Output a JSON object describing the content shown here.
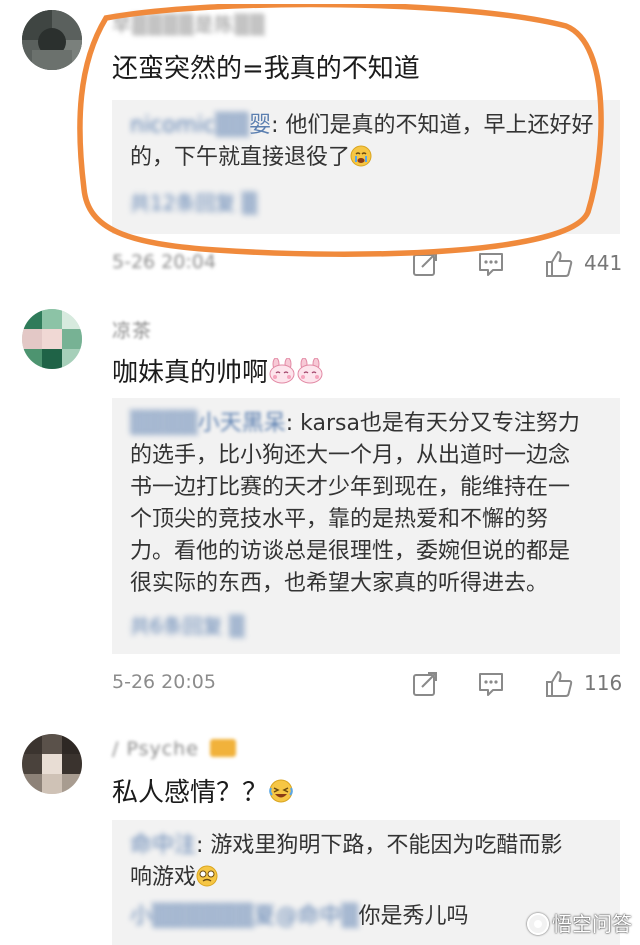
{
  "comments": [
    {
      "username": "早▒▒▒▒是陈▒▒",
      "text": "还蛮突然的=我真的不知道",
      "reply": {
        "user": "nicomic▒▒",
        "suffix": "婴",
        "lines": [
          "们是真的不知道，早上还好好",
          "的，下午就直接退役了"
        ],
        "colon": ": 他"
      },
      "more_replies": "共12条回复 ▒",
      "timestamp": "5-26 20:04",
      "likes": "441"
    },
    {
      "username": "凉茶",
      "text": "咖妹真的帅啊",
      "reply": {
        "user": "▒▒▒▒",
        "suffix": "小天黑呆",
        "lines": [
          "karsa也是有天分又专注努力",
          "的选手，比小狗还大一个月，从出道时一边念",
          "书一边打比赛的天才少年到现在，能维持在一",
          "个顶尖的竞技水平，靠的是热爱和不懈的努",
          "力。看他的访谈总是很理性，委婉但说的都是",
          "很实际的东西，也希望大家真的听得进去。"
        ],
        "colon": ": "
      },
      "more_replies": "共6条回复 ▒",
      "timestamp": "5-26 20:05",
      "likes": "116"
    },
    {
      "username": "/ Psyche",
      "text": "私人感情？？",
      "reply": {
        "user": "命中注",
        "colon": ": ",
        "lines": [
          "游戏里狗明下路，不能因为吃醋而影",
          "响游戏"
        ],
        "line3_user": "小▒▒▒▒▒▒夏@命中▒",
        "line3_text": "你是秀儿吗"
      }
    }
  ],
  "watermark": "悟空问答",
  "colors": {
    "highlight": "#f08a3c",
    "reply_bg": "#f2f2f2",
    "link": "#5b7fb0"
  },
  "icons": [
    "share-icon",
    "comment-icon",
    "like-icon"
  ]
}
